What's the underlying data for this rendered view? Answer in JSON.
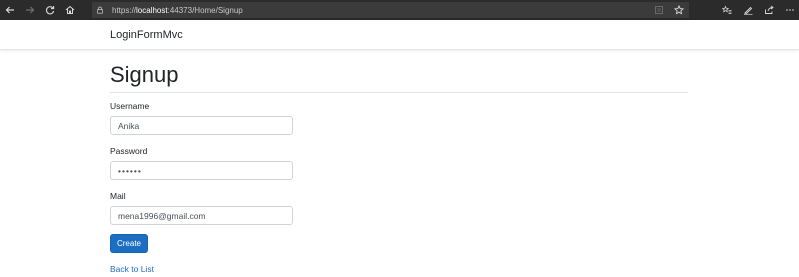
{
  "browser": {
    "url_scheme": "https://",
    "url_host": "localhost",
    "url_rest": ":44373/Home/Signup",
    "icons": [
      "back-icon",
      "forward-icon",
      "refresh-icon",
      "home-icon",
      "lock-icon",
      "reading-view-icon",
      "favorite-star-icon",
      "favorites-hub-icon",
      "pen-icon",
      "share-icon",
      "more-icon"
    ]
  },
  "navbar": {
    "brand": "LoginFormMvc"
  },
  "page": {
    "title": "Signup"
  },
  "form": {
    "username": {
      "label": "Username",
      "value": "Anika"
    },
    "password": {
      "label": "Password",
      "value": "••••••"
    },
    "mail": {
      "label": "Mail",
      "value": "mena1996@gmail.com"
    },
    "submit_label": "Create"
  },
  "links": {
    "back": "Back to List"
  },
  "colors": {
    "primary": "#1b6ec2",
    "chrome": "#2b2b2b",
    "address_bar": "#3b3b3b"
  }
}
